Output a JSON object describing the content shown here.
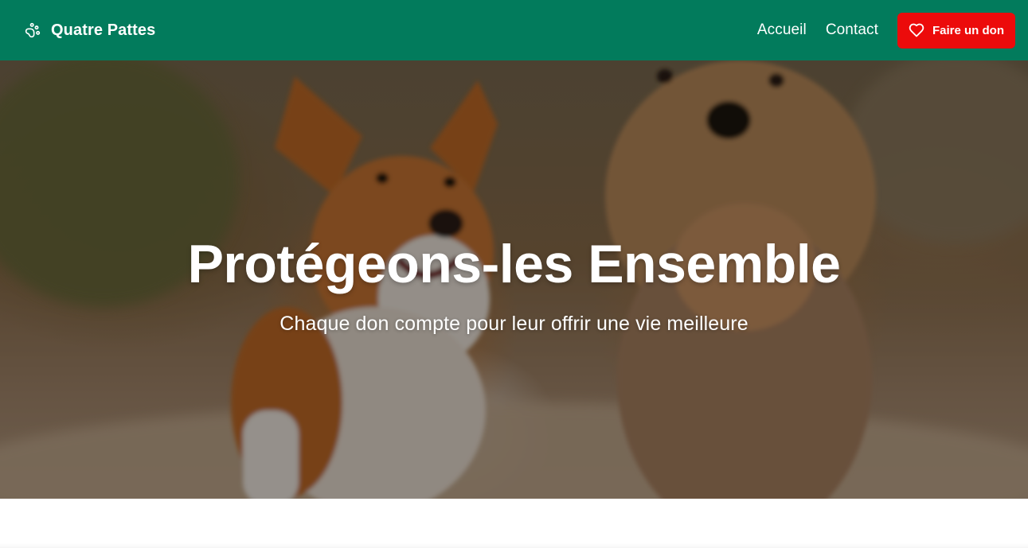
{
  "navbar": {
    "brand_name": "Quatre Pattes",
    "brand_icon": "paw-icon",
    "links": [
      {
        "label": "Accueil"
      },
      {
        "label": "Contact"
      }
    ],
    "donate_label": "Faire un don",
    "donate_icon": "heart-icon",
    "background_color": "#027b5c",
    "donate_color": "#ec0b0b"
  },
  "hero": {
    "title": "Protégeons-les Ensemble",
    "subtitle": "Chaque don compte pour leur offrir une vie meilleure"
  }
}
